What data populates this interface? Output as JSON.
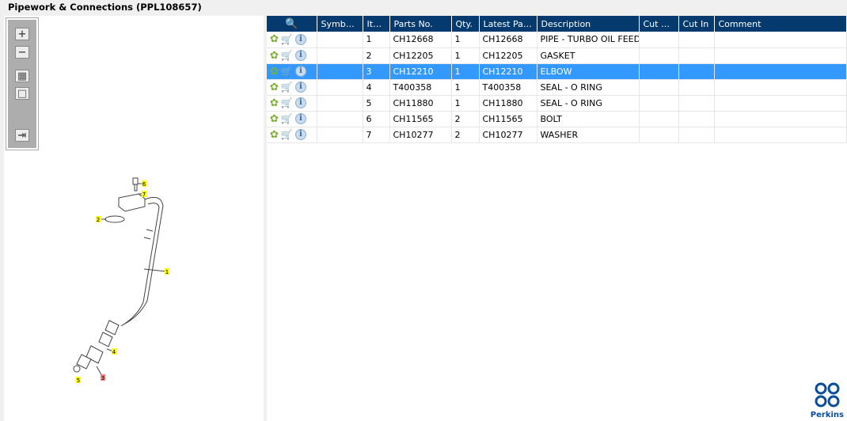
{
  "title": "Pipework & Connections (PPL108657)",
  "toolbar": {
    "zoom_in": "zoom-in",
    "zoom_out": "zoom-out",
    "fit": "fit",
    "actual": "actual-size",
    "export": "export"
  },
  "table": {
    "headers": [
      "Symbol(s)",
      "Item",
      "Parts No.",
      "Qty.",
      "Latest Part...",
      "Description",
      "Cut Out",
      "Cut In",
      "Comment"
    ],
    "selected_index": 2,
    "rows": [
      {
        "symbol": "",
        "item": "1",
        "part": "CH12668",
        "qty": "1",
        "latest": "CH12668",
        "desc": "PIPE - TURBO OIL FEED",
        "cutout": "",
        "cutin": "",
        "comment": ""
      },
      {
        "symbol": "",
        "item": "2",
        "part": "CH12205",
        "qty": "1",
        "latest": "CH12205",
        "desc": "GASKET",
        "cutout": "",
        "cutin": "",
        "comment": ""
      },
      {
        "symbol": "",
        "item": "3",
        "part": "CH12210",
        "qty": "1",
        "latest": "CH12210",
        "desc": "ELBOW",
        "cutout": "",
        "cutin": "",
        "comment": ""
      },
      {
        "symbol": "",
        "item": "4",
        "part": "T400358",
        "qty": "1",
        "latest": "T400358",
        "desc": "SEAL - O RING",
        "cutout": "",
        "cutin": "",
        "comment": ""
      },
      {
        "symbol": "",
        "item": "5",
        "part": "CH11880",
        "qty": "1",
        "latest": "CH11880",
        "desc": "SEAL - O RING",
        "cutout": "",
        "cutin": "",
        "comment": ""
      },
      {
        "symbol": "",
        "item": "6",
        "part": "CH11565",
        "qty": "2",
        "latest": "CH11565",
        "desc": "BOLT",
        "cutout": "",
        "cutin": "",
        "comment": ""
      },
      {
        "symbol": "",
        "item": "7",
        "part": "CH10277",
        "qty": "2",
        "latest": "CH10277",
        "desc": "WASHER",
        "cutout": "",
        "cutin": "",
        "comment": ""
      }
    ]
  },
  "diagram": {
    "callouts": [
      "6",
      "7",
      "2",
      "1",
      "4",
      "3",
      "5"
    ],
    "highlight": "3"
  },
  "logo": {
    "text": "Perkins"
  },
  "colors": {
    "header": "#053a6e",
    "selected": "#3399ff",
    "callout": "#ffff00",
    "callout_selected": "#f08080"
  }
}
